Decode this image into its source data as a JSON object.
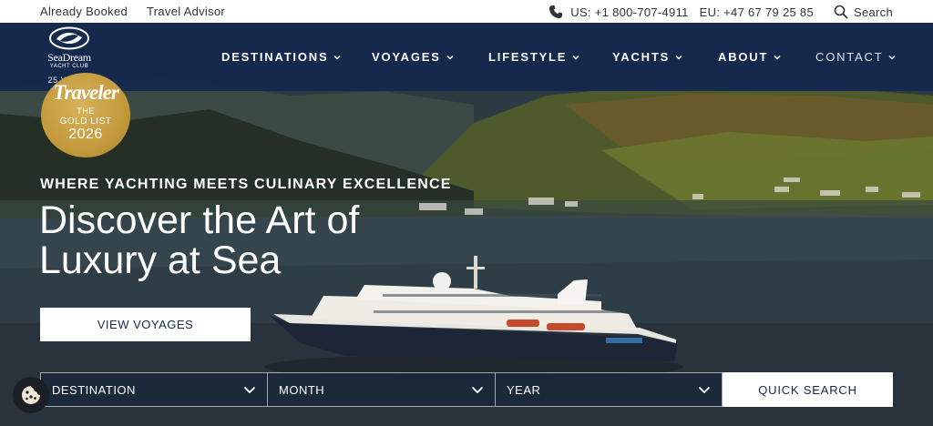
{
  "topbar": {
    "links": [
      "Already Booked",
      "Travel Advisor"
    ],
    "phone_us": "US: +1 800-707-4911",
    "phone_eu": "EU: +47 67 79 25 85",
    "search_label": "Search"
  },
  "logo": {
    "brand": "SeaDream",
    "sub": "YACHT CLUB",
    "years": "25 YEARS"
  },
  "nav": {
    "items": [
      {
        "label": "DESTINATIONS"
      },
      {
        "label": "VOYAGES"
      },
      {
        "label": "LIFESTYLE"
      },
      {
        "label": "YACHTS"
      },
      {
        "label": "ABOUT"
      },
      {
        "label": "CONTACT"
      }
    ]
  },
  "badge": {
    "magazine": "Traveler",
    "line1": "THE",
    "line2": "GOLD LIST",
    "year": "2026"
  },
  "hero": {
    "eyebrow": "WHERE YACHTING MEETS CULINARY EXCELLENCE",
    "headline_line1": "Discover the Art of",
    "headline_line2": "Luxury at Sea",
    "cta": "VIEW VOYAGES"
  },
  "search": {
    "destination": "DESTINATION",
    "month": "MONTH",
    "year": "YEAR",
    "button": "QUICK SEARCH"
  },
  "colors": {
    "nav_bg": "#14284e",
    "badge_gold": "#c49a3d",
    "button_text": "#14284e"
  }
}
